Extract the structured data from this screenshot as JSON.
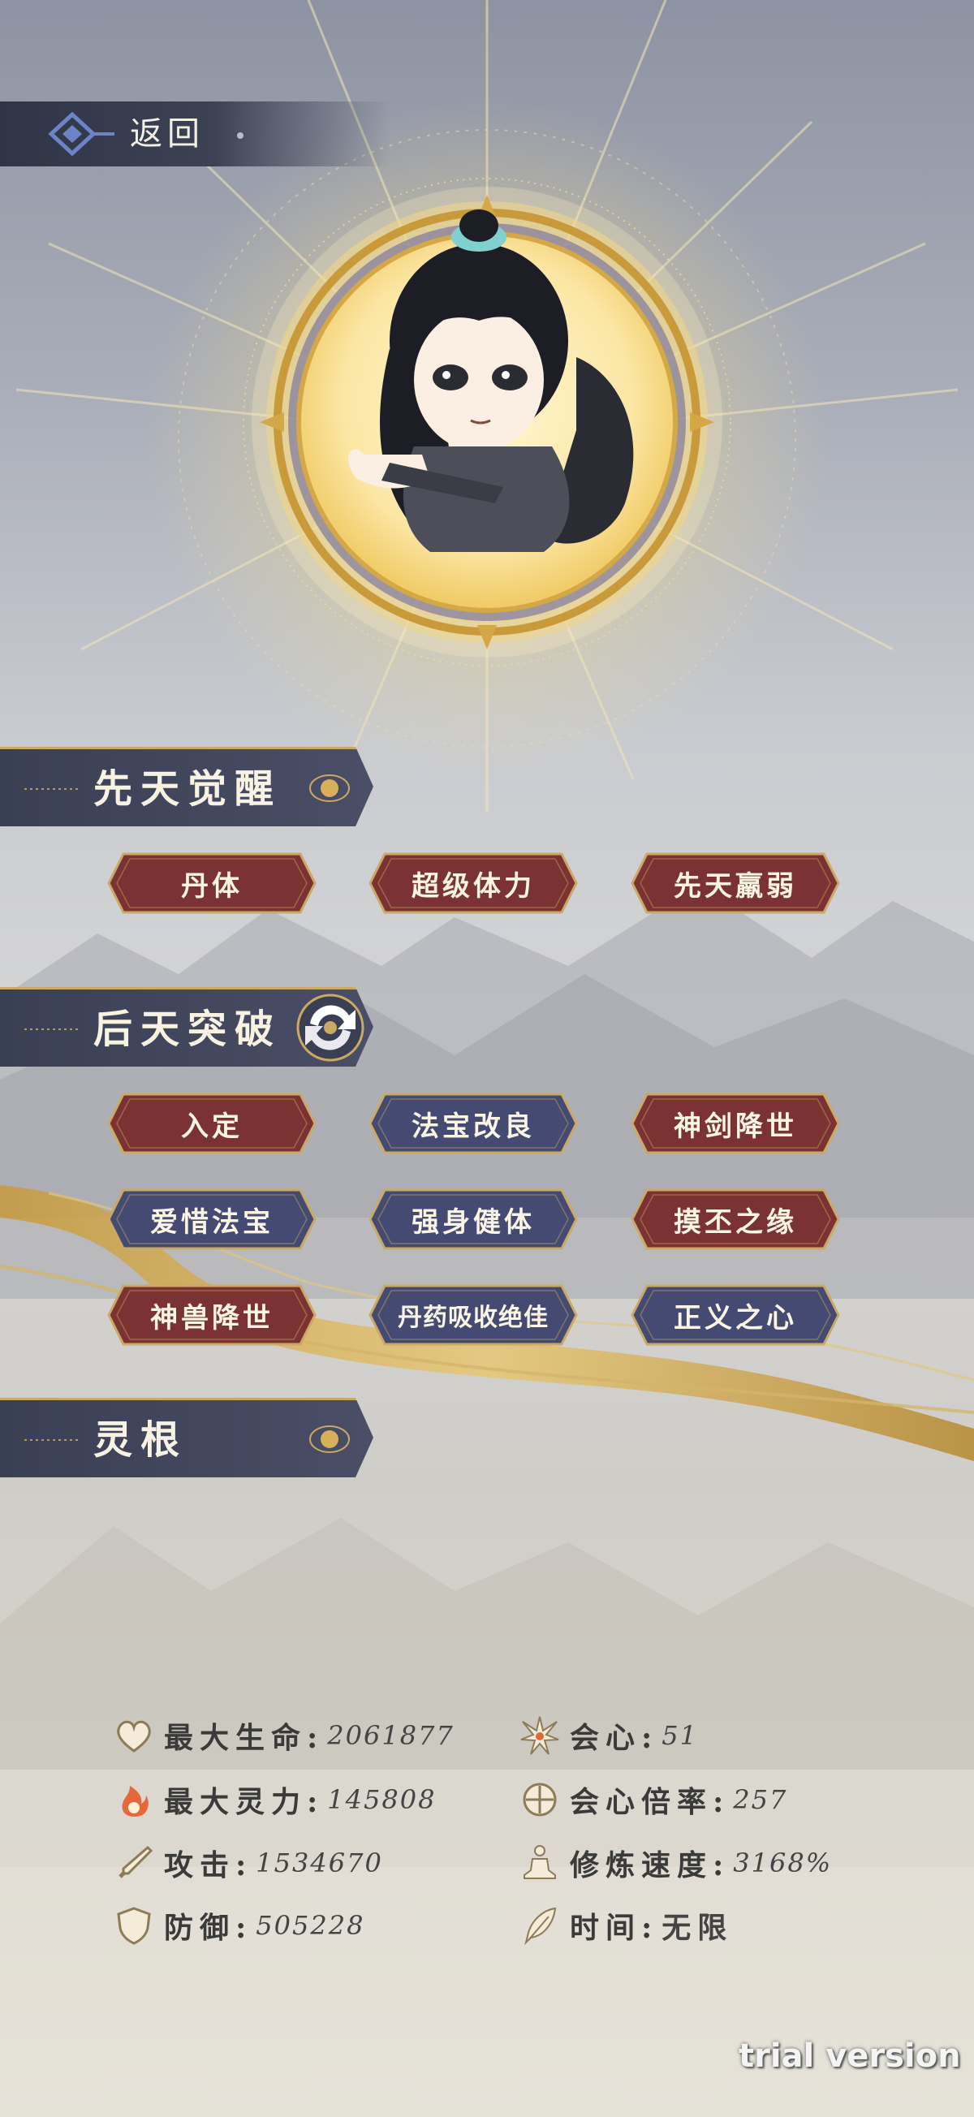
{
  "nav": {
    "back_label": "返回"
  },
  "sections": {
    "innate": {
      "title": "先天觉醒",
      "tags": [
        {
          "label": "丹体",
          "variant": "red"
        },
        {
          "label": "超级体力",
          "variant": "red"
        },
        {
          "label": "先天羸弱",
          "variant": "red"
        }
      ]
    },
    "acquired": {
      "title": "后天突破",
      "tags": [
        {
          "label": "入定",
          "variant": "red"
        },
        {
          "label": "法宝改良",
          "variant": "blue"
        },
        {
          "label": "神剑降世",
          "variant": "red"
        },
        {
          "label": "爱惜法宝",
          "variant": "blue"
        },
        {
          "label": "强身健体",
          "variant": "blue"
        },
        {
          "label": "摸丕之缘",
          "variant": "red"
        },
        {
          "label": "神兽降世",
          "variant": "red"
        },
        {
          "label": "丹药吸收绝佳",
          "variant": "blue"
        },
        {
          "label": "正义之心",
          "variant": "blue"
        }
      ]
    },
    "root": {
      "title": "灵根"
    }
  },
  "stats": {
    "max_hp": {
      "label": "最大生命:",
      "value": "2061877",
      "icon": "heart-icon"
    },
    "max_sp": {
      "label": "最大灵力:",
      "value": "145808",
      "icon": "flame-icon"
    },
    "attack": {
      "label": "攻击:",
      "value": "1534670",
      "icon": "sword-icon"
    },
    "defense": {
      "label": "防御:",
      "value": "505228",
      "icon": "shield-icon"
    },
    "crit": {
      "label": "会心:",
      "value": "51",
      "icon": "burst-icon"
    },
    "crit_mult": {
      "label": "会心倍率:",
      "value": "257",
      "icon": "target-icon"
    },
    "cultivation_speed": {
      "label": "修炼速度:",
      "value": "3168%",
      "icon": "meditation-icon"
    },
    "time": {
      "label": "时间:",
      "value": "无限",
      "icon": "feather-icon"
    }
  },
  "watermark": "trial version",
  "colors": {
    "tag_red": "#7a3232",
    "tag_blue": "#454a72",
    "gold": "#c9a964",
    "header_bg": "#3e4358"
  }
}
